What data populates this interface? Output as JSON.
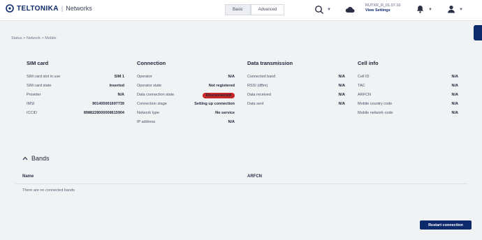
{
  "header": {
    "brand": "TELTONIKA",
    "section": "Networks",
    "mode_basic": "Basic",
    "mode_advanced": "Advanced",
    "firmware": "RUTXR_R_01.07.10",
    "view_settings": "View Settings"
  },
  "breadcrumb": "Status  >  Network  >  Mobile",
  "sim": {
    "title": "SIM card",
    "rows": [
      {
        "label": "SIM card slot in use",
        "value": "SIM 1"
      },
      {
        "label": "SIM card state",
        "value": "Inserted"
      },
      {
        "label": "Provider",
        "value": "N/A"
      },
      {
        "label": "IMSI",
        "value": "901405001697739"
      },
      {
        "label": "ICCID",
        "value": "8988228000008615904"
      }
    ]
  },
  "connection": {
    "title": "Connection",
    "rows": [
      {
        "label": "Operator",
        "value": "N/A"
      },
      {
        "label": "Operator state",
        "value": "Not registered"
      },
      {
        "label": "Data connection state",
        "value": "Disconnected"
      },
      {
        "label": "Connection stage",
        "value": "Setting up connection"
      },
      {
        "label": "Network type",
        "value": "No service"
      },
      {
        "label": "IP address",
        "value": "N/A"
      }
    ]
  },
  "data_transmission": {
    "title": "Data transmission",
    "rows": [
      {
        "label": "Connected band",
        "value": "N/A"
      },
      {
        "label": "RSSI (dBm)",
        "value": "N/A"
      },
      {
        "label": "Data received",
        "value": "N/A"
      },
      {
        "label": "Data sent",
        "value": "N/A"
      }
    ]
  },
  "cell_info": {
    "title": "Cell info",
    "rows": [
      {
        "label": "Cell ID",
        "value": "N/A"
      },
      {
        "label": "TAC",
        "value": "N/A"
      },
      {
        "label": "ARFCN",
        "value": "N/A"
      },
      {
        "label": "Mobile country code",
        "value": "N/A"
      },
      {
        "label": "Mobile network code",
        "value": "N/A"
      }
    ]
  },
  "bands": {
    "title": "Bands",
    "col_name": "Name",
    "col_arfcn": "ARFCN",
    "empty": "There are no connected bands"
  },
  "restart_label": "Restart connection",
  "colors": {
    "brand": "#0d2a6b",
    "disconnected": "#c62828"
  }
}
